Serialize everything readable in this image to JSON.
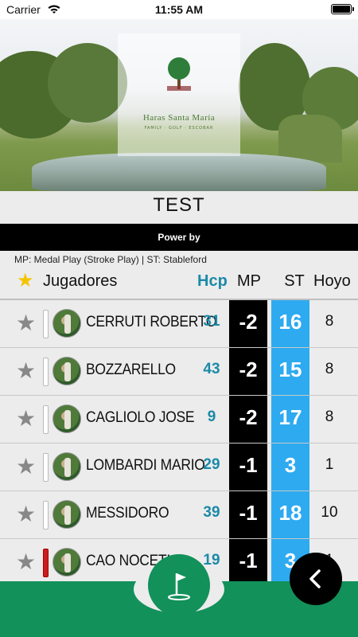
{
  "status_bar": {
    "carrier": "Carrier",
    "time": "11:55 AM"
  },
  "header": {
    "logo_text": "Haras Santa María",
    "logo_subtitle": "FAMILY · GOLF · ESCOBAR",
    "title": "TEST",
    "powered_by": "Power by"
  },
  "legend": "MP: Medal Play (Stroke Play) | ST: Stableford",
  "table": {
    "columns": {
      "players": "Jugadores",
      "hcp": "Hcp",
      "mp": "MP",
      "st": "ST",
      "hoyo": "Hoyo"
    },
    "rows": [
      {
        "name": "CERRUTI ROBERTO",
        "hcp": "31",
        "mp": "-2",
        "st": "16",
        "hoyo": "8",
        "marker": "white"
      },
      {
        "name": "BOZZARELLO",
        "hcp": "43",
        "mp": "-2",
        "st": "15",
        "hoyo": "8",
        "marker": "white"
      },
      {
        "name": "CAGLIOLO JOSE",
        "hcp": "9",
        "mp": "-2",
        "st": "17",
        "hoyo": "8",
        "marker": "white"
      },
      {
        "name": "LOMBARDI MARIO",
        "hcp": "29",
        "mp": "-1",
        "st": "3",
        "hoyo": "1",
        "marker": "white"
      },
      {
        "name": "MESSIDORO",
        "hcp": "39",
        "mp": "-1",
        "st": "18",
        "hoyo": "10",
        "marker": "white"
      },
      {
        "name": "CAO NOCETI",
        "hcp": "19",
        "mp": "-1",
        "st": "3",
        "hoyo": "1",
        "marker": "red"
      }
    ]
  },
  "icons": {
    "favorite": "star-icon",
    "golf": "golf-flag-icon",
    "back": "chevron-left-icon"
  },
  "colors": {
    "mp_column": "#000000",
    "st_column": "#2eaaf0",
    "hcp_text": "#1c8aa8",
    "bottom_bar": "#12915a",
    "favorite_header_star": "#f4c400"
  }
}
